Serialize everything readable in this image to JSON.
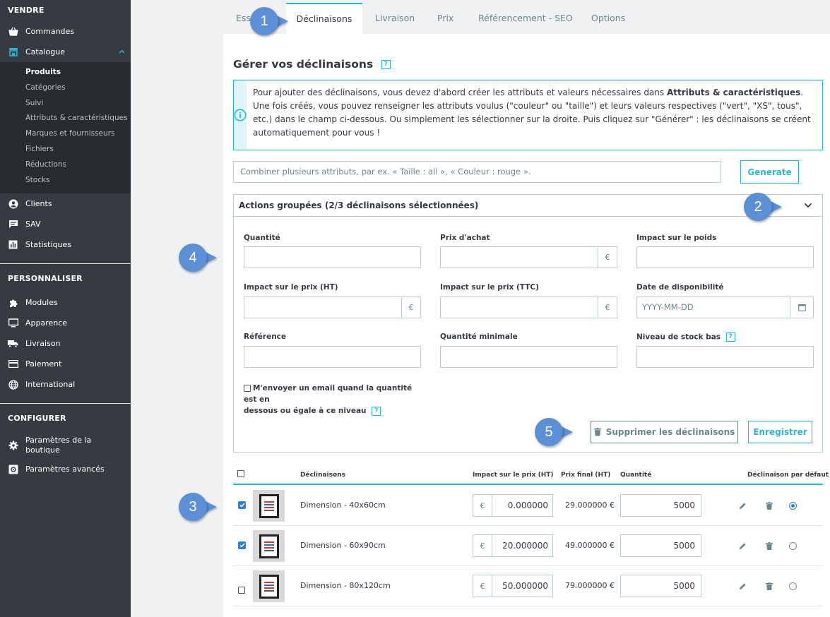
{
  "sidebar": {
    "sections": {
      "sell": "VENDRE",
      "customize": "PERSONNALISER",
      "configure": "CONFIGURER"
    },
    "items": {
      "orders": "Commandes",
      "catalog": "Catalogue",
      "customers": "Clients",
      "sav": "SAV",
      "stats": "Statistiques",
      "modules": "Modules",
      "appearance": "Apparence",
      "shipping": "Livraison",
      "payment": "Paiement",
      "international": "International",
      "shop_params_1": "Paramètres de la",
      "shop_params_2": "boutique",
      "advanced_params": "Paramètres avancés"
    },
    "catalog_sub": [
      "Produits",
      "Catégories",
      "Suivi",
      "Attributs & caractéristiques",
      "Marques et fournisseurs",
      "Fichiers",
      "Réductions",
      "Stocks"
    ]
  },
  "tabs": [
    "Ess",
    "Déclinaisons",
    "Livraison",
    "Prix",
    "Référencement - SEO",
    "Options"
  ],
  "page": {
    "title": "Gérer vos déclinaisons",
    "help": "?",
    "alert_part1": "Pour ajouter des déclinaisons, vous devez d'abord créer les attributs et valeurs nécessaires dans ",
    "alert_bold": "Attributs & caractéristiques",
    "alert_part2": ". Une fois créés, vous pouvez renseigner les attributs voulus (\"couleur\" ou \"taille\") et leurs valeurs respectives (\"vert\", \"XS\", tous\", etc.) dans le champ ci-dessous. Ou simplement les sélectionner sur la droite. Puis cliquez sur \"Générer\" : les déclinaisons se créent automatiquement pour vous !",
    "combine_placeholder": "Combiner plusieurs attributs, par ex. « Taille : all », « Couleur : rouge ».",
    "generate_label": "Generate"
  },
  "bulk": {
    "title": "Actions groupées (2/3 déclinaisons sélectionnées)",
    "labels": {
      "quantity": "Quantité",
      "purchase_price": "Prix d'achat",
      "weight_impact": "Impact sur le poids",
      "price_impact_ht": "Impact sur le prix (HT)",
      "price_impact_ttc": "Impact sur le prix (TTC)",
      "availability_date": "Date de disponibilité",
      "reference": "Référence",
      "min_quantity": "Quantité minimale",
      "low_stock": "Niveau de stock bas"
    },
    "currency": "€",
    "date_placeholder": "YYYY-MM-DD",
    "email_line1": "M'envoyer un email quand la quantité est en",
    "email_line2": "dessous ou égale à ce niveau",
    "delete_label": "Supprimer les déclinaisons",
    "save_label": "Enregistrer"
  },
  "table": {
    "headers": {
      "combinations": "Déclinaisons",
      "impact": "Impact sur le prix (HT)",
      "final": "Prix final (HT)",
      "quantity": "Quantité",
      "default": "Déclinaison par défaut"
    },
    "rows": [
      {
        "name": "Dimension - 40x60cm",
        "currency": "€",
        "impact": "0.000000",
        "final": "29.000000 €",
        "qty": "5000",
        "checked": true,
        "default": true
      },
      {
        "name": "Dimension - 60x90cm",
        "currency": "€",
        "impact": "20.000000",
        "final": "49.000000 €",
        "qty": "5000",
        "checked": true,
        "default": false
      },
      {
        "name": "Dimension - 80x120cm",
        "currency": "€",
        "impact": "50.000000",
        "final": "79.000000 €",
        "qty": "5000",
        "checked": false,
        "default": false
      }
    ]
  },
  "callouts": [
    "1",
    "2",
    "3",
    "4",
    "5"
  ],
  "colors": {
    "accent": "#25b9d7",
    "sidebar": "#363a41",
    "callout": "#5b8fd6"
  }
}
